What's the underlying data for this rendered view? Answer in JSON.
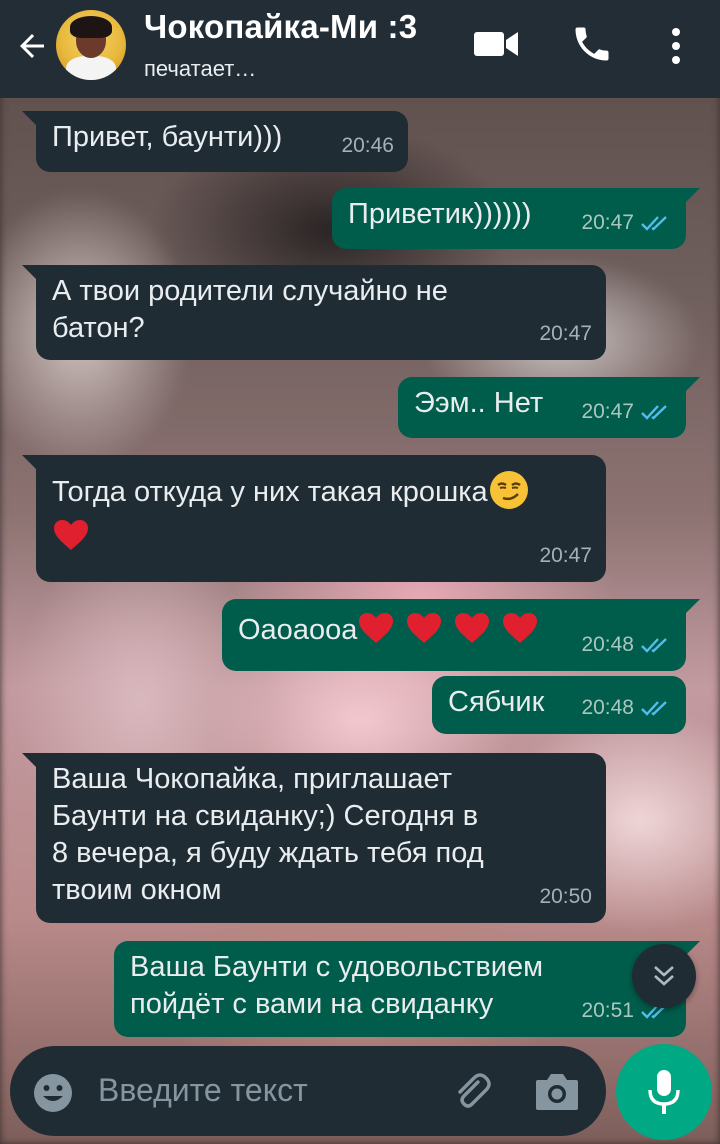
{
  "header": {
    "contact_name": "Чокопайка-Ми :3",
    "status": "печатает…",
    "icons": [
      "back-arrow-icon",
      "avatar",
      "video-call-icon",
      "phone-icon",
      "more-options-icon"
    ]
  },
  "messages": [
    {
      "direction": "in",
      "text": "Привет, баунти)))",
      "time": "20:46",
      "read": false
    },
    {
      "direction": "out",
      "text": "Приветик))))))",
      "time": "20:47",
      "read": true
    },
    {
      "direction": "in",
      "text": "А твои родители случайно не\nбатон?",
      "time": "20:47",
      "read": false
    },
    {
      "direction": "out",
      "text": "Ээм.. Нет",
      "time": "20:47",
      "read": true
    },
    {
      "direction": "in",
      "text": "Тогда откуда у них такая крошка",
      "emoji": [
        "smirk",
        "red-heart"
      ],
      "time": "20:47",
      "read": false
    },
    {
      "direction": "out",
      "text": "Оаоаооа",
      "emoji": [
        "red-heart",
        "red-heart",
        "red-heart",
        "red-heart"
      ],
      "time": "20:48",
      "read": true
    },
    {
      "direction": "out",
      "text": "Сябчик",
      "time": "20:48",
      "read": true
    },
    {
      "direction": "in",
      "text": "Ваша Чокопайка, приглашает\nБаунти на свиданку;) Сегодня в\n8 вечера, я буду ждать тебя под\nтвоим окном",
      "time": "20:50",
      "read": false
    },
    {
      "direction": "out",
      "text": "Ваша Баунти с удовольствием\nпойдёт с вами на свиданку",
      "time": "20:51",
      "read": true
    }
  ],
  "composer": {
    "placeholder": "Введите текст",
    "icons": [
      "emoji-icon",
      "attach-icon",
      "camera-icon",
      "mic-icon"
    ]
  },
  "colors": {
    "header_bg": "#232d36",
    "incoming_bubble": "#1f2c34",
    "outgoing_bubble": "#005c4b",
    "read_ticks": "#53bdeb",
    "accent": "#00a884"
  }
}
